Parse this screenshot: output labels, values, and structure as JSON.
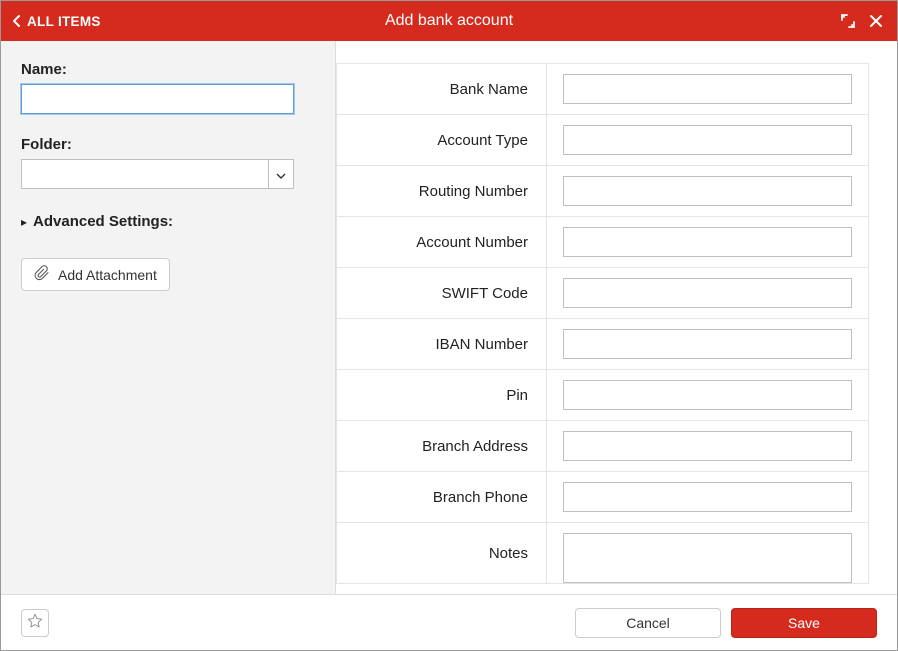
{
  "colors": {
    "brand": "#d52b1e"
  },
  "header": {
    "breadcrumb": "ALL ITEMS",
    "title": "Add bank account",
    "icons": {
      "back": "chevron-left",
      "expand": "expand",
      "close": "close"
    }
  },
  "left": {
    "name_label": "Name:",
    "name_value": "",
    "folder_label": "Folder:",
    "folder_value": "",
    "advanced_label": "Advanced Settings:",
    "attach_label": "Add Attachment"
  },
  "form_fields": [
    {
      "key": "bank_name",
      "label": "Bank Name",
      "value": "",
      "type": "text"
    },
    {
      "key": "account_type",
      "label": "Account Type",
      "value": "",
      "type": "text"
    },
    {
      "key": "routing_number",
      "label": "Routing Number",
      "value": "",
      "type": "text"
    },
    {
      "key": "account_number",
      "label": "Account Number",
      "value": "",
      "type": "text"
    },
    {
      "key": "swift_code",
      "label": "SWIFT Code",
      "value": "",
      "type": "text"
    },
    {
      "key": "iban_number",
      "label": "IBAN Number",
      "value": "",
      "type": "text"
    },
    {
      "key": "pin",
      "label": "Pin",
      "value": "",
      "type": "text"
    },
    {
      "key": "branch_address",
      "label": "Branch Address",
      "value": "",
      "type": "text"
    },
    {
      "key": "branch_phone",
      "label": "Branch Phone",
      "value": "",
      "type": "text"
    },
    {
      "key": "notes",
      "label": "Notes",
      "value": "",
      "type": "textarea"
    }
  ],
  "footer": {
    "cancel": "Cancel",
    "save": "Save"
  }
}
